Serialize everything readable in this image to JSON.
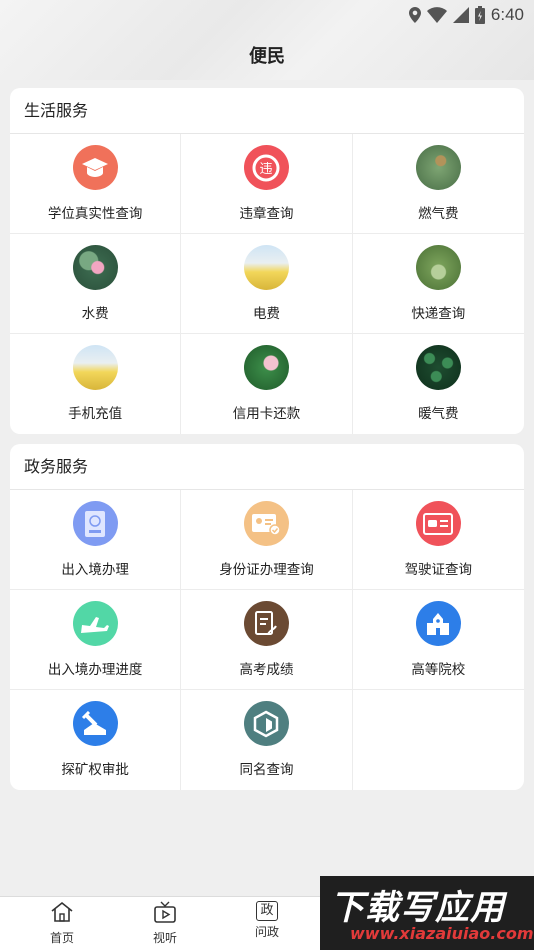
{
  "status_bar": {
    "time": "6:40"
  },
  "page_title": "便民",
  "life_services": {
    "title": "生活服务",
    "items": [
      {
        "label": "学位真实性查询",
        "icon": "graduation-cap-icon",
        "color": "#f0715a"
      },
      {
        "label": "违章查询",
        "icon": "violation-icon",
        "color": "#f0525a"
      },
      {
        "label": "燃气费",
        "icon": "dragonfly-photo-icon"
      },
      {
        "label": "水费",
        "icon": "lotus-photo-icon"
      },
      {
        "label": "电费",
        "icon": "flower-field-photo-icon"
      },
      {
        "label": "快递查询",
        "icon": "plant-photo-icon"
      },
      {
        "label": "手机充值",
        "icon": "flower-field-photo-icon"
      },
      {
        "label": "信用卡还款",
        "icon": "pink-lotus-photo-icon"
      },
      {
        "label": "暖气费",
        "icon": "leaves-photo-icon"
      }
    ]
  },
  "gov_services": {
    "title": "政务服务",
    "items": [
      {
        "label": "出入境办理",
        "icon": "passport-icon",
        "color": "#7f9bf2",
        "badge": "护照"
      },
      {
        "label": "身份证办理查询",
        "icon": "id-card-icon",
        "color": "#f4c185"
      },
      {
        "label": "驾驶证查询",
        "icon": "driver-license-icon",
        "color": "#f0525a"
      },
      {
        "label": "出入境办理进度",
        "icon": "airplane-icon",
        "color": "#52d7a6"
      },
      {
        "label": "高考成绩",
        "icon": "exam-paper-icon",
        "color": "#6b4a33"
      },
      {
        "label": "高等院校",
        "icon": "school-building-icon",
        "color": "#2d7ee8"
      },
      {
        "label": "探矿权审批",
        "icon": "mining-icon",
        "color": "#2d7ee8"
      },
      {
        "label": "同名查询",
        "icon": "cube-icon",
        "color": "#4f7f80"
      }
    ]
  },
  "bottom_nav": [
    {
      "label": "首页",
      "icon": "home-icon"
    },
    {
      "label": "视听",
      "icon": "tv-icon"
    },
    {
      "label": "问政",
      "icon": "zheng-icon",
      "glyph": "政"
    }
  ],
  "watermark": {
    "title": "下载写应用",
    "url": "www.xiazaiuiao.com"
  }
}
